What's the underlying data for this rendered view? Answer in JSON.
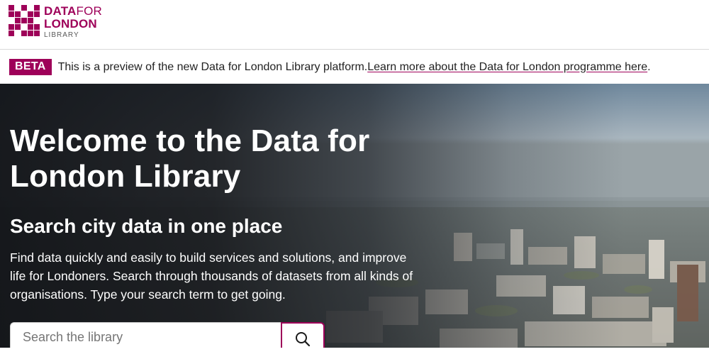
{
  "logo": {
    "line1_bold": "DATA",
    "line1_thin": "FOR",
    "line2": "LONDON",
    "line3": "LIBRARY",
    "brand_color": "#9e0059"
  },
  "beta_banner": {
    "tag": "BETA",
    "message": "This is a preview of the new Data for London Library platform. ",
    "link_text": "Learn more about the Data for London programme here",
    "trailing": "."
  },
  "hero": {
    "title": "Welcome to the Data for London Library",
    "subtitle": "Search city data in one place",
    "description": "Find data quickly and easily to build services and solutions, and improve life for Londoners. Search through thousands of datasets from all kinds of organisations. Type your search term to get going."
  },
  "search": {
    "placeholder": "Search the library",
    "value": "",
    "button_icon": "search-icon"
  }
}
